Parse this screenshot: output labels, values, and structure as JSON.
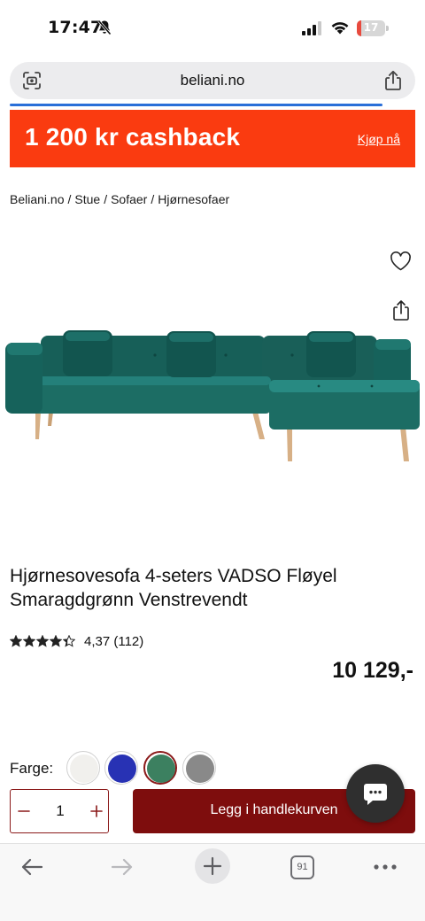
{
  "status_bar": {
    "time": "17:47",
    "battery": "17",
    "battery_level": 0.17
  },
  "browser": {
    "url": "beliani.no",
    "load_progress": 0.92,
    "tab_count": "91"
  },
  "banner": {
    "title": "1 200 kr cashback",
    "link": "Kjøp nå",
    "color": "#fa3b10"
  },
  "breadcrumb": [
    "Beliani.no",
    "Stue",
    "Sofaer",
    "Hjørnesofaer"
  ],
  "breadcrumb_separator": "/",
  "product": {
    "title": "Hjørnesovesofa 4-seters VADSO Fløyel Smaragdgrønn Venstrevendt",
    "rating_value": 4.37,
    "rating_text": "4,37 (112)",
    "price": "10 129,-",
    "color_label": "Farge:",
    "swatches": [
      {
        "name": "white",
        "color": "#f1f0ed",
        "selected": false
      },
      {
        "name": "blue",
        "color": "#2832b4",
        "selected": false
      },
      {
        "name": "green",
        "color": "#3c8060",
        "selected": true
      },
      {
        "name": "grey",
        "color": "#898989",
        "selected": false
      }
    ]
  },
  "cart": {
    "quantity": "1",
    "add_to_cart_label": "Legg i handlekurven",
    "accent_color": "#7e0d0d"
  },
  "icons": {
    "favorite": "heart-icon",
    "share": "share-icon",
    "chat": "chat-icon"
  }
}
